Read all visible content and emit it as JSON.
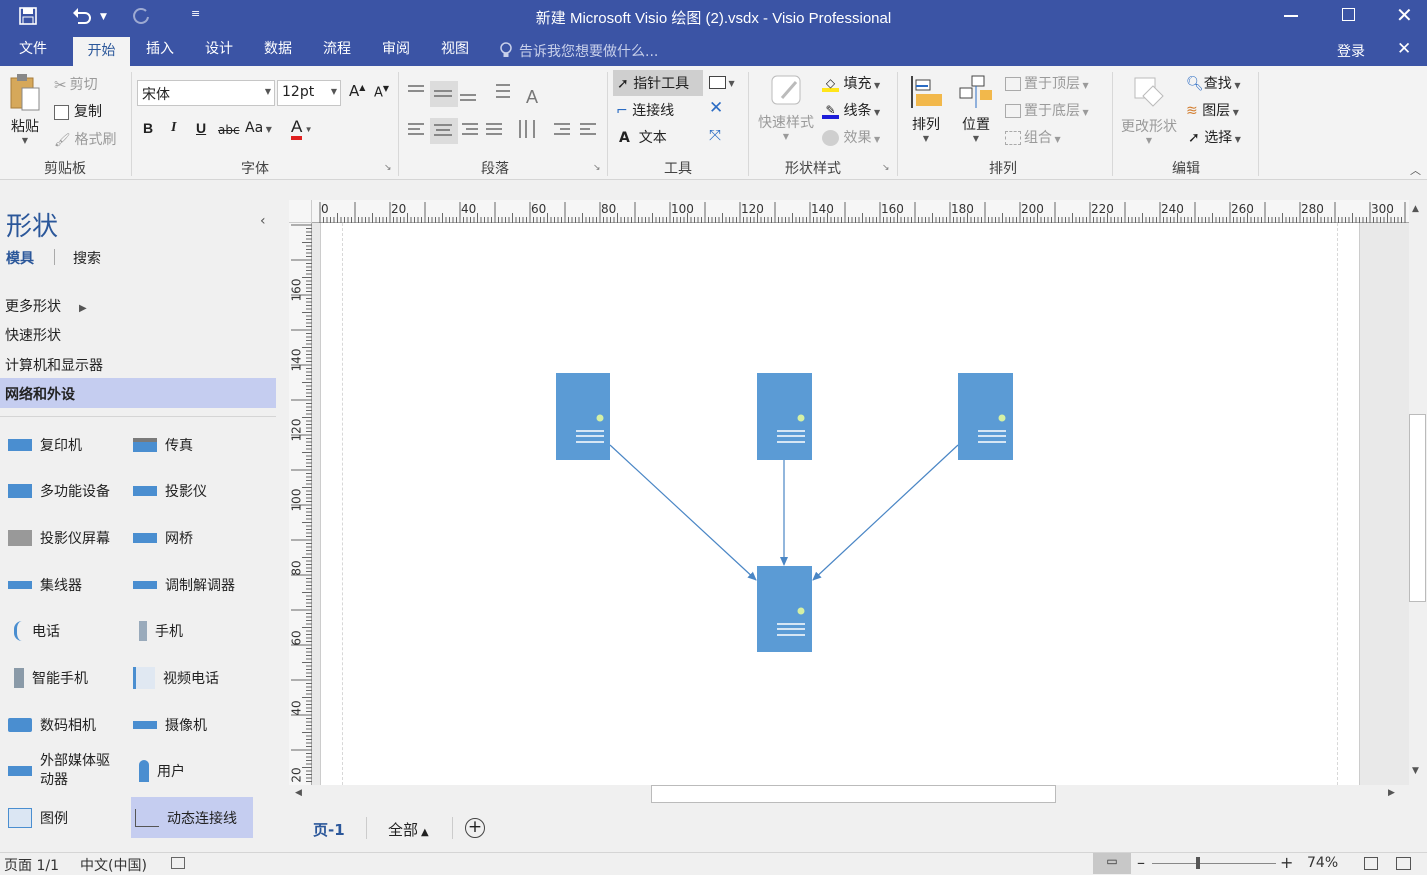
{
  "window": {
    "title": "新建 Microsoft Visio 绘图 (2).vsdx - Visio Professional"
  },
  "tabs": [
    "文件",
    "开始",
    "插入",
    "设计",
    "数据",
    "流程",
    "审阅",
    "视图"
  ],
  "tell_me": "告诉我您想要做什么...",
  "signin": "登录",
  "clipboard": {
    "paste": "粘贴",
    "cut": "剪切",
    "copy": "复制",
    "format_painter": "格式刷",
    "label": "剪贴板"
  },
  "font": {
    "name": "宋体",
    "size": "12pt",
    "label": "字体",
    "bold": "B",
    "italic": "I",
    "underline": "U",
    "strike": "abc",
    "case": "Aa",
    "color_btn": "A",
    "grow": "A",
    "shrink": "A"
  },
  "paragraph": {
    "label": "段落"
  },
  "tools": {
    "pointer": "指针工具",
    "connector": "连接线",
    "text": "文本",
    "label": "工具"
  },
  "shape_styles": {
    "quick": "快速样式",
    "fill": "填充",
    "line": "线条",
    "effects": "效果",
    "label": "形状样式"
  },
  "arrange": {
    "align": "排列",
    "position": "位置",
    "bring_front": "置于顶层",
    "send_back": "置于底层",
    "group": "组合",
    "label": "排列"
  },
  "editing": {
    "change_shape": "更改形状",
    "find": "查找",
    "layers": "图层",
    "select": "选择",
    "label": "编辑"
  },
  "shapes_pane": {
    "title": "形状",
    "tab_stencils": "模具",
    "tab_search": "搜索",
    "more_shapes": "更多形状",
    "stencils": [
      "快速形状",
      "计算机和显示器",
      "网络和外设"
    ],
    "items": [
      [
        "复印机",
        "传真"
      ],
      [
        "多功能设备",
        "投影仪"
      ],
      [
        "投影仪屏幕",
        "网桥"
      ],
      [
        "集线器",
        "调制解调器"
      ],
      [
        "电话",
        "手机"
      ],
      [
        "智能手机",
        "视频电话"
      ],
      [
        "数码相机",
        "摄像机"
      ],
      [
        "外部媒体驱动器",
        "用户"
      ],
      [
        "图例",
        "动态连接线"
      ]
    ]
  },
  "ruler": {
    "h": [
      "0",
      "20",
      "40",
      "60",
      "80",
      "100",
      "120",
      "140",
      "160",
      "180",
      "200",
      "220",
      "240",
      "260",
      "280",
      "300"
    ],
    "v": [
      "160",
      "140",
      "120",
      "100",
      "80",
      "60",
      "40",
      "20"
    ]
  },
  "page_tabs": {
    "page": "页-1",
    "all": "全部"
  },
  "status": {
    "page": "页面 1/1",
    "language": "中文(中国)",
    "zoom": "74%"
  },
  "colors": {
    "server": "#5b9bd5",
    "connector": "#4a86c5",
    "accent": "#3b54a5"
  }
}
